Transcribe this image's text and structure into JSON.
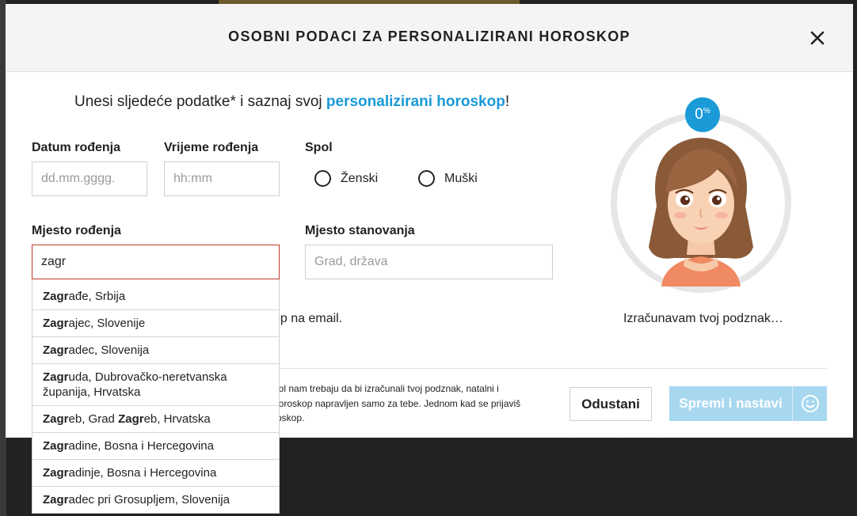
{
  "modal": {
    "title": "OSOBNI PODACI ZA PERSONALIZIRANI HOROSKOP",
    "intro_prefix": "Unesi sljedeće podatke* i saznaj svoj ",
    "intro_link": "personalizirani horoskop",
    "intro_suffix": "!"
  },
  "form": {
    "dob_label": "Datum rođenja",
    "dob_placeholder": "dd.mm.gggg.",
    "tob_label": "Vrijeme rođenja",
    "tob_placeholder": "hh:mm",
    "gender_label": "Spol",
    "gender_options": [
      "Ženski",
      "Muški"
    ],
    "birthplace_label": "Mjesto rođenja",
    "birthplace_value": "zagr",
    "residence_label": "Mjesto stanovanja",
    "residence_placeholder": "Grad, država",
    "email_text": "op na email."
  },
  "autocomplete": {
    "items": [
      {
        "parts": [
          [
            "Zagr",
            true
          ],
          [
            "ađe, Srbija",
            false
          ]
        ]
      },
      {
        "parts": [
          [
            "Zagr",
            true
          ],
          [
            "ajec, Slovenije",
            false
          ]
        ]
      },
      {
        "parts": [
          [
            "Zagr",
            true
          ],
          [
            "adec, Slovenija",
            false
          ]
        ]
      },
      {
        "parts": [
          [
            "Zagr",
            true
          ],
          [
            "uda, Dubrovačko-neretvanska županija, Hrvatska",
            false
          ]
        ]
      },
      {
        "parts": [
          [
            "Zagr",
            true
          ],
          [
            "eb, Grad ",
            false
          ],
          [
            "Zagr",
            true
          ],
          [
            "eb, Hrvatska",
            false
          ]
        ]
      },
      {
        "parts": [
          [
            "Zagr",
            true
          ],
          [
            "adine, Bosna i Hercegovina",
            false
          ]
        ]
      },
      {
        "parts": [
          [
            "Zagr",
            true
          ],
          [
            "adinje, Bosna i Hercegovina",
            false
          ]
        ]
      },
      {
        "parts": [
          [
            "Zagr",
            true
          ],
          [
            "adec pri Grosupljem, Slovenija",
            false
          ]
        ]
      }
    ]
  },
  "footer": {
    "disclaimer": "pol nam trebaju da bi izračunali tvoj podznak, natalni i horoskop napravljen samo za tebe. Jednom kad se prijaviš roskop.",
    "cancel_label": "Odustani",
    "save_label": "Spremi i nastavi"
  },
  "sidebar": {
    "percent": "0",
    "percent_sign": "%",
    "status": "Izračunavam tvoj podznak…"
  },
  "colors": {
    "accent": "#1a9ad6",
    "save_disabled": "#a8d8f0",
    "error_border": "#c0392b"
  },
  "icons": {
    "close": "close-icon",
    "smile": "smile-icon",
    "avatar": "girl-avatar"
  }
}
